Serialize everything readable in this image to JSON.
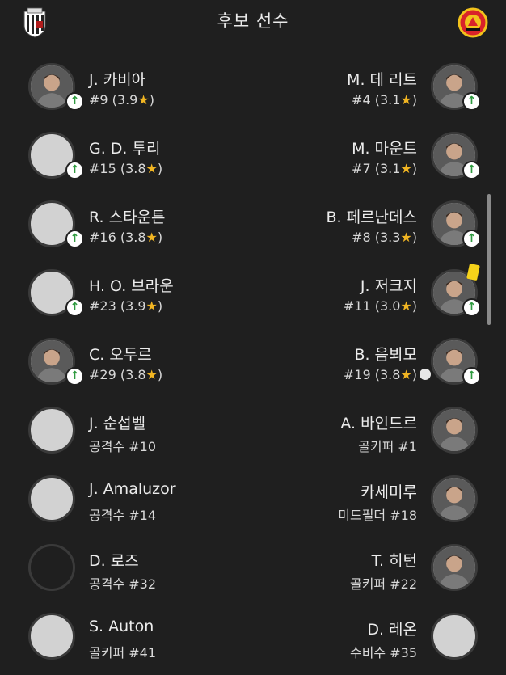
{
  "header": {
    "title": "후보 선수",
    "home_crest_icon": "grimsby-crest-icon",
    "away_crest_icon": "man-utd-crest-icon"
  },
  "home": [
    {
      "name": "J. 카비아",
      "detail": "#9 (3.9",
      "star": "★",
      "close": ")",
      "subbed_on": true,
      "photo": true
    },
    {
      "name": "G. D. 투리",
      "detail": "#15 (3.8",
      "star": "★",
      "close": ")",
      "subbed_on": true,
      "photo": false
    },
    {
      "name": "R. 스타운튼",
      "detail": "#16 (3.8",
      "star": "★",
      "close": ")",
      "subbed_on": true,
      "photo": false
    },
    {
      "name": "H. O. 브라운",
      "detail": "#23 (3.9",
      "star": "★",
      "close": ")",
      "subbed_on": true,
      "photo": false
    },
    {
      "name": "C. 오두르",
      "detail": "#29 (3.8",
      "star": "★",
      "close": ")",
      "subbed_on": true,
      "photo": true
    },
    {
      "name": "J. 순섭벨",
      "detail": "공격수 #10",
      "subbed_on": false,
      "photo": false
    },
    {
      "name": "J. Amaluzor",
      "detail": "공격수 #14",
      "subbed_on": false,
      "photo": false
    },
    {
      "name": "D. 로즈",
      "detail": "공격수 #32",
      "subbed_on": false,
      "photo": false,
      "empty": true
    },
    {
      "name": "S. Auton",
      "detail": "골키퍼 #41",
      "subbed_on": false,
      "photo": false
    }
  ],
  "away": [
    {
      "name": "M. 데 리트",
      "detail": "#4 (3.1",
      "star": "★",
      "close": ")",
      "subbed_on": true,
      "photo": true
    },
    {
      "name": "M. 마운트",
      "detail": "#7 (3.1",
      "star": "★",
      "close": ")",
      "subbed_on": true,
      "photo": true
    },
    {
      "name": "B. 페르난데스",
      "detail": "#8 (3.3",
      "star": "★",
      "close": ")",
      "subbed_on": true,
      "photo": true
    },
    {
      "name": "J. 저크지",
      "detail": "#11 (3.0",
      "star": "★",
      "close": ")",
      "subbed_on": true,
      "photo": true,
      "yellow_card": true
    },
    {
      "name": "B. 음뵈모",
      "detail": "#19 (3.8",
      "star": "★",
      "close": ")",
      "subbed_on": true,
      "photo": true,
      "ball_icon": true
    },
    {
      "name": "A. 바인드르",
      "detail": "골키퍼 #1",
      "subbed_on": false,
      "photo": true
    },
    {
      "name": "카세미루",
      "detail": "미드필더 #18",
      "subbed_on": false,
      "photo": true
    },
    {
      "name": "T. 히턴",
      "detail": "골키퍼 #22",
      "subbed_on": false,
      "photo": true
    },
    {
      "name": "D. 레온",
      "detail": "수비수 #35",
      "subbed_on": false,
      "photo": false
    }
  ],
  "colors": {
    "background": "#1f1f1f",
    "star": "#f1b522",
    "sub_arrow": "#2e9a3f",
    "yellow_card": "#f6d21a"
  }
}
